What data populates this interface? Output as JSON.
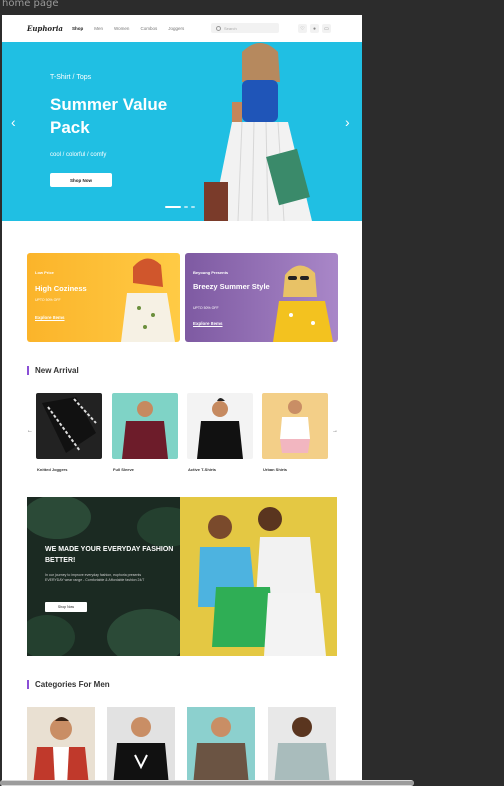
{
  "frame_label": "home page",
  "header": {
    "logo": "Euphoria",
    "nav": [
      "Shop",
      "Men",
      "Women",
      "Combos",
      "Joggers"
    ],
    "active_nav": "Shop",
    "search_placeholder": "Search",
    "icons": [
      "heart-icon",
      "user-icon",
      "cart-icon"
    ]
  },
  "hero": {
    "subtitle": "T-Shirt / Tops",
    "title": "Summer Value Pack",
    "tagline": "cool / colorful / comfy",
    "button": "Shop Now",
    "bg_color": "#20bfe3",
    "slide_count": 3,
    "active_slide": 1
  },
  "promos": [
    {
      "small": "Low Price",
      "title": "High Coziness",
      "offer": "UPTO 50% OFF",
      "link": "Explore Items",
      "color": "#fbb42a"
    },
    {
      "small": "Beyoung Presents",
      "title": "Breezy Summer Style",
      "offer": "UPTO 50% OFF",
      "link": "Explore Items",
      "color": "#8c68b0"
    }
  ],
  "new_arrival": {
    "title": "New Arrival",
    "items": [
      "Knitted Joggers",
      "Full Sleeve",
      "Active T-Shirts",
      "Urban Shirts"
    ]
  },
  "banner": {
    "title": "WE MADE YOUR EVERYDAY FASHION BETTER!",
    "text": "In our journey to improve everyday fashion, euphoria presents EVERYDAY wear range - Comfortable & Affordable fashion 24/7",
    "button": "Shop Now"
  },
  "categories_men": {
    "title": "Categories For Men"
  },
  "colors": {
    "accent": "#8a4fd6",
    "hero_blue": "#20bfe3"
  }
}
